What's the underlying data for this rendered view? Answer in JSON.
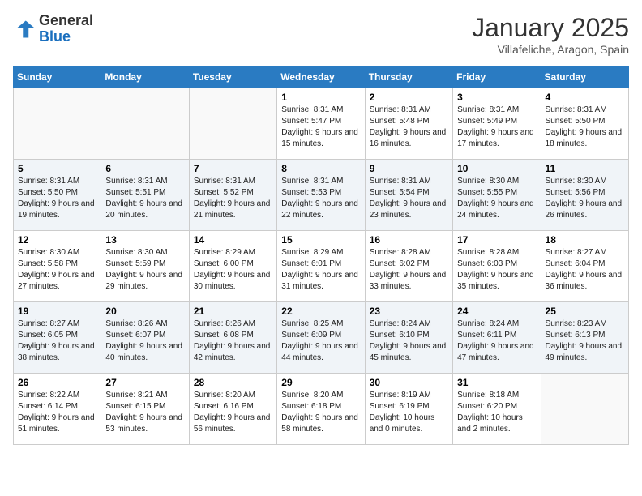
{
  "header": {
    "logo_line1": "General",
    "logo_line2": "Blue",
    "month": "January 2025",
    "location": "Villafeliche, Aragon, Spain"
  },
  "days_of_week": [
    "Sunday",
    "Monday",
    "Tuesday",
    "Wednesday",
    "Thursday",
    "Friday",
    "Saturday"
  ],
  "weeks": [
    [
      {
        "day": "",
        "info": ""
      },
      {
        "day": "",
        "info": ""
      },
      {
        "day": "",
        "info": ""
      },
      {
        "day": "1",
        "sunrise": "8:31 AM",
        "sunset": "5:47 PM",
        "daylight": "9 hours and 15 minutes."
      },
      {
        "day": "2",
        "sunrise": "8:31 AM",
        "sunset": "5:48 PM",
        "daylight": "9 hours and 16 minutes."
      },
      {
        "day": "3",
        "sunrise": "8:31 AM",
        "sunset": "5:49 PM",
        "daylight": "9 hours and 17 minutes."
      },
      {
        "day": "4",
        "sunrise": "8:31 AM",
        "sunset": "5:50 PM",
        "daylight": "9 hours and 18 minutes."
      }
    ],
    [
      {
        "day": "5",
        "sunrise": "8:31 AM",
        "sunset": "5:50 PM",
        "daylight": "9 hours and 19 minutes."
      },
      {
        "day": "6",
        "sunrise": "8:31 AM",
        "sunset": "5:51 PM",
        "daylight": "9 hours and 20 minutes."
      },
      {
        "day": "7",
        "sunrise": "8:31 AM",
        "sunset": "5:52 PM",
        "daylight": "9 hours and 21 minutes."
      },
      {
        "day": "8",
        "sunrise": "8:31 AM",
        "sunset": "5:53 PM",
        "daylight": "9 hours and 22 minutes."
      },
      {
        "day": "9",
        "sunrise": "8:31 AM",
        "sunset": "5:54 PM",
        "daylight": "9 hours and 23 minutes."
      },
      {
        "day": "10",
        "sunrise": "8:30 AM",
        "sunset": "5:55 PM",
        "daylight": "9 hours and 24 minutes."
      },
      {
        "day": "11",
        "sunrise": "8:30 AM",
        "sunset": "5:56 PM",
        "daylight": "9 hours and 26 minutes."
      }
    ],
    [
      {
        "day": "12",
        "sunrise": "8:30 AM",
        "sunset": "5:58 PM",
        "daylight": "9 hours and 27 minutes."
      },
      {
        "day": "13",
        "sunrise": "8:30 AM",
        "sunset": "5:59 PM",
        "daylight": "9 hours and 29 minutes."
      },
      {
        "day": "14",
        "sunrise": "8:29 AM",
        "sunset": "6:00 PM",
        "daylight": "9 hours and 30 minutes."
      },
      {
        "day": "15",
        "sunrise": "8:29 AM",
        "sunset": "6:01 PM",
        "daylight": "9 hours and 31 minutes."
      },
      {
        "day": "16",
        "sunrise": "8:28 AM",
        "sunset": "6:02 PM",
        "daylight": "9 hours and 33 minutes."
      },
      {
        "day": "17",
        "sunrise": "8:28 AM",
        "sunset": "6:03 PM",
        "daylight": "9 hours and 35 minutes."
      },
      {
        "day": "18",
        "sunrise": "8:27 AM",
        "sunset": "6:04 PM",
        "daylight": "9 hours and 36 minutes."
      }
    ],
    [
      {
        "day": "19",
        "sunrise": "8:27 AM",
        "sunset": "6:05 PM",
        "daylight": "9 hours and 38 minutes."
      },
      {
        "day": "20",
        "sunrise": "8:26 AM",
        "sunset": "6:07 PM",
        "daylight": "9 hours and 40 minutes."
      },
      {
        "day": "21",
        "sunrise": "8:26 AM",
        "sunset": "6:08 PM",
        "daylight": "9 hours and 42 minutes."
      },
      {
        "day": "22",
        "sunrise": "8:25 AM",
        "sunset": "6:09 PM",
        "daylight": "9 hours and 44 minutes."
      },
      {
        "day": "23",
        "sunrise": "8:24 AM",
        "sunset": "6:10 PM",
        "daylight": "9 hours and 45 minutes."
      },
      {
        "day": "24",
        "sunrise": "8:24 AM",
        "sunset": "6:11 PM",
        "daylight": "9 hours and 47 minutes."
      },
      {
        "day": "25",
        "sunrise": "8:23 AM",
        "sunset": "6:13 PM",
        "daylight": "9 hours and 49 minutes."
      }
    ],
    [
      {
        "day": "26",
        "sunrise": "8:22 AM",
        "sunset": "6:14 PM",
        "daylight": "9 hours and 51 minutes."
      },
      {
        "day": "27",
        "sunrise": "8:21 AM",
        "sunset": "6:15 PM",
        "daylight": "9 hours and 53 minutes."
      },
      {
        "day": "28",
        "sunrise": "8:20 AM",
        "sunset": "6:16 PM",
        "daylight": "9 hours and 56 minutes."
      },
      {
        "day": "29",
        "sunrise": "8:20 AM",
        "sunset": "6:18 PM",
        "daylight": "9 hours and 58 minutes."
      },
      {
        "day": "30",
        "sunrise": "8:19 AM",
        "sunset": "6:19 PM",
        "daylight": "10 hours and 0 minutes."
      },
      {
        "day": "31",
        "sunrise": "8:18 AM",
        "sunset": "6:20 PM",
        "daylight": "10 hours and 2 minutes."
      },
      {
        "day": "",
        "info": ""
      }
    ]
  ]
}
